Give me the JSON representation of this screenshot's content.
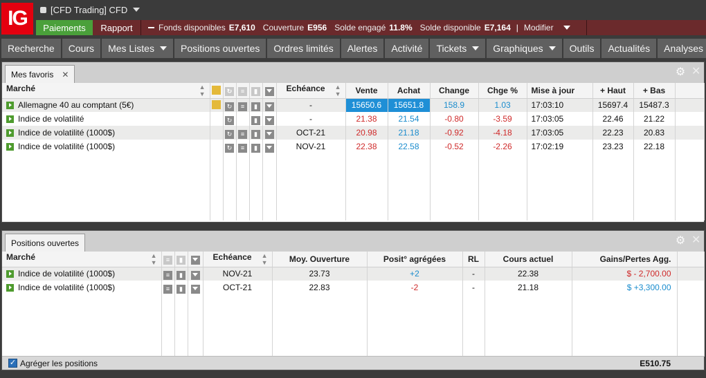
{
  "header": {
    "logo_text": "IG",
    "account": "[CFD Trading] CFD",
    "payments_label": "Paiements",
    "report_label": "Rapport",
    "funds_available_label": "Fonds disponibles",
    "funds_available_value": "E7,610",
    "coverage_label": "Couverture",
    "coverage_value": "E956",
    "committed_label": "Solde engagé",
    "committed_value": "11.8%",
    "balance_label": "Solde disponible",
    "balance_value": "E7,164",
    "separator": "|",
    "modify_label": "Modifier"
  },
  "nav": [
    {
      "label": "Recherche",
      "dropdown": false
    },
    {
      "label": "Cours",
      "dropdown": false
    },
    {
      "label": "Mes Listes",
      "dropdown": true
    },
    {
      "label": "Positions ouvertes",
      "dropdown": false
    },
    {
      "label": "Ordres limités",
      "dropdown": false
    },
    {
      "label": "Alertes",
      "dropdown": false
    },
    {
      "label": "Activité",
      "dropdown": false
    },
    {
      "label": "Tickets",
      "dropdown": true
    },
    {
      "label": "Graphiques",
      "dropdown": true
    },
    {
      "label": "Outils",
      "dropdown": false
    },
    {
      "label": "Actualités",
      "dropdown": false
    },
    {
      "label": "Analyses",
      "dropdown": true
    }
  ],
  "favorites": {
    "tab_label": "Mes favoris",
    "columns": [
      "Marché",
      "Echéance",
      "Vente",
      "Achat",
      "Change",
      "Chge %",
      "Mise à jour",
      "+ Haut",
      "+ Bas"
    ],
    "rows": [
      {
        "market": "Allemagne 40 au comptant (5€)",
        "expiry": "-",
        "sell": "15650.6",
        "buy": "15651.8",
        "change": "158.9",
        "change_pct": "1.03",
        "updated": "17:03:10",
        "high": "15697.4",
        "low": "15487.3",
        "bulb": true,
        "highlight": true,
        "dir": "up"
      },
      {
        "market": "Indice de volatilité",
        "expiry": "-",
        "sell": "21.38",
        "buy": "21.54",
        "change": "-0.80",
        "change_pct": "-3.59",
        "updated": "17:03:05",
        "high": "22.46",
        "low": "21.22",
        "bulb": false,
        "highlight": false,
        "dir": "down"
      },
      {
        "market": "Indice de volatilité (1000$)",
        "expiry": "OCT-21",
        "sell": "20.98",
        "buy": "21.18",
        "change": "-0.92",
        "change_pct": "-4.18",
        "updated": "17:03:05",
        "high": "22.23",
        "low": "20.83",
        "bulb": false,
        "highlight": false,
        "dir": "down"
      },
      {
        "market": "Indice de volatilité (1000$)",
        "expiry": "NOV-21",
        "sell": "22.38",
        "buy": "22.58",
        "change": "-0.52",
        "change_pct": "-2.26",
        "updated": "17:02:19",
        "high": "23.23",
        "low": "22.18",
        "bulb": false,
        "highlight": false,
        "dir": "down"
      }
    ]
  },
  "positions": {
    "tab_label": "Positions ouvertes",
    "columns": [
      "Marché",
      "Echéance",
      "Moy. Ouverture",
      "Posit° agrégées",
      "RL",
      "Cours actuel",
      "Gains/Pertes Agg."
    ],
    "rows": [
      {
        "market": "Indice de volatilité (1000$)",
        "expiry": "NOV-21",
        "avg_open": "23.73",
        "aggregated": "+2",
        "rl": "-",
        "current": "22.38",
        "pnl": "$ - 2,700.00",
        "dir": "down",
        "agg_dir": "up"
      },
      {
        "market": "Indice de volatilité (1000$)",
        "expiry": "OCT-21",
        "avg_open": "22.83",
        "aggregated": "-2",
        "rl": "-",
        "current": "21.18",
        "pnl": "$ +3,300.00",
        "dir": "up",
        "agg_dir": "down"
      }
    ],
    "aggregate_label": "Agréger les positions",
    "total": "E510.75"
  }
}
